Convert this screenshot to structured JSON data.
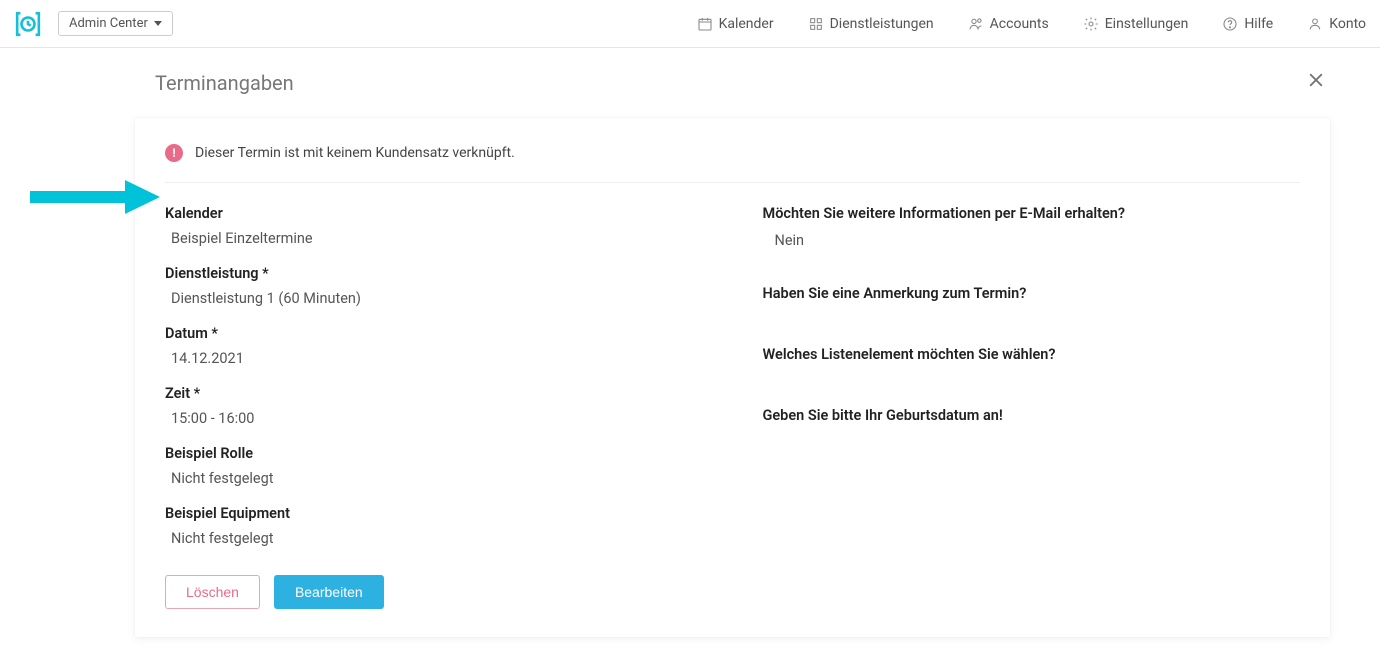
{
  "topbar": {
    "selector_label": "Admin Center",
    "nav": {
      "kalender": "Kalender",
      "dienstleistungen": "Dienstleistungen",
      "accounts": "Accounts",
      "einstellungen": "Einstellungen",
      "hilfe": "Hilfe",
      "konto": "Konto"
    }
  },
  "page": {
    "title": "Terminangaben"
  },
  "alert": {
    "icon_glyph": "!",
    "text": "Dieser Termin ist mit keinem Kundensatz verknüpft."
  },
  "left_fields": {
    "kalender": {
      "label": "Kalender",
      "value": "Beispiel Einzeltermine"
    },
    "dienstleistung": {
      "label": "Dienstleistung *",
      "value": "Dienstleistung 1 (60 Minuten)"
    },
    "datum": {
      "label": "Datum *",
      "value": "14.12.2021"
    },
    "zeit": {
      "label": "Zeit *",
      "value": "15:00 - 16:00"
    },
    "rolle": {
      "label": "Beispiel Rolle",
      "value": "Nicht festgelegt"
    },
    "equipment": {
      "label": "Beispiel Equipment",
      "value": "Nicht festgelegt"
    }
  },
  "right_fields": {
    "info_email": {
      "label": "Möchten Sie weitere Informationen per E-Mail erhalten?",
      "value": "Nein"
    },
    "anmerkung": {
      "label": "Haben Sie eine Anmerkung zum Termin?",
      "value": ""
    },
    "listenelement": {
      "label": "Welches Listenelement möchten Sie wählen?",
      "value": ""
    },
    "geburtsdatum": {
      "label": "Geben Sie bitte Ihr Geburtsdatum an!",
      "value": ""
    }
  },
  "buttons": {
    "delete": "Löschen",
    "edit": "Bearbeiten"
  },
  "colors": {
    "accent": "#14c0d6",
    "primary_button": "#2db1e1",
    "danger": "#e86b8a"
  }
}
